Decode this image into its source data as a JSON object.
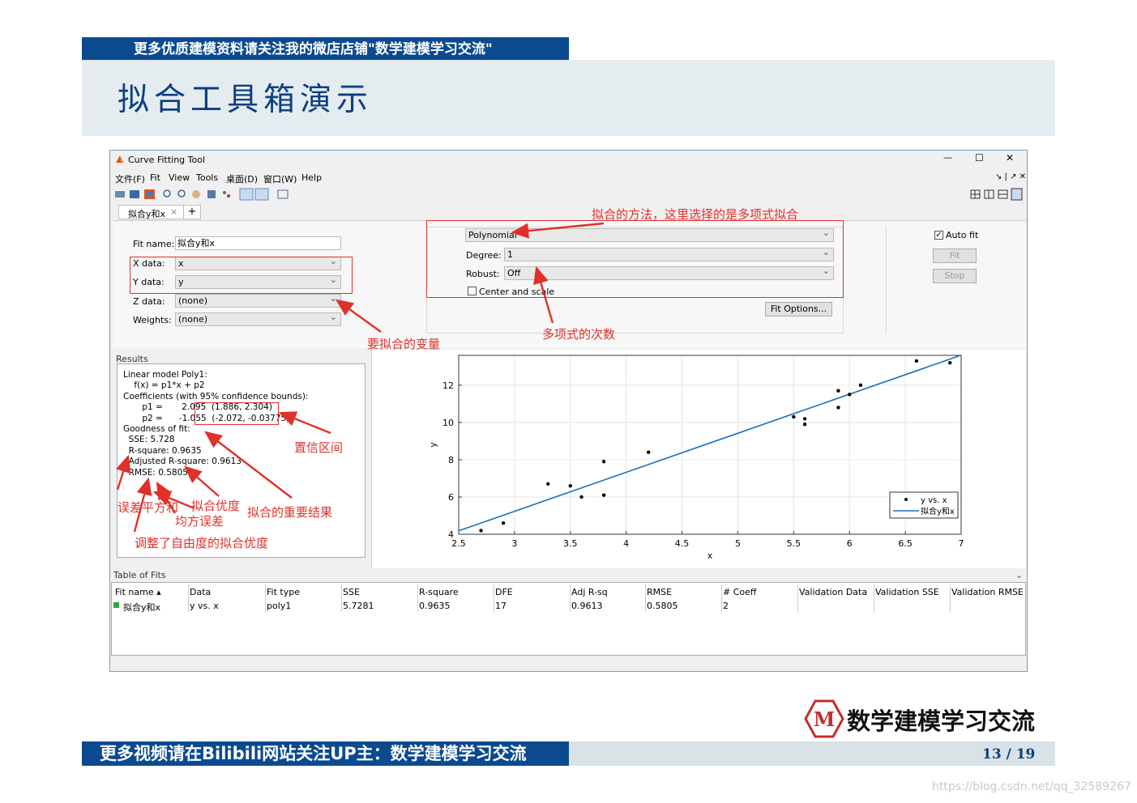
{
  "slide": {
    "banner": "更多优质建模资料请关注我的微店店铺\"数学建模学习交流\"",
    "title": "拟合工具箱演示",
    "footer": "更多视频请在Bilibili网站关注UP主：数学建模学习交流",
    "page": "13 / 19",
    "brand": "数学建模学习交流",
    "logo_letter": "M",
    "watermark": "https://blog.csdn.net/qq_32589267"
  },
  "window": {
    "title": "Curve Fitting Tool",
    "controls": {
      "minimize": "—",
      "maximize": "☐",
      "close": "✕"
    },
    "menu": [
      "文件(F)",
      "Fit",
      "View",
      "Tools",
      "桌面(D)",
      "窗口(W)",
      "Help"
    ],
    "tab": "拟合y和x",
    "tab_close": "×",
    "tab_add": "+"
  },
  "fit": {
    "name_label": "Fit name:",
    "name_value": "拟合y和x",
    "x_label": "X data:",
    "x_value": "x",
    "y_label": "Y data:",
    "y_value": "y",
    "z_label": "Z data:",
    "z_value": "(none)",
    "w_label": "Weights:",
    "w_value": "(none)",
    "method": "Polynomial",
    "degree_label": "Degree:",
    "degree": "1",
    "robust_label": "Robust:",
    "robust": "Off",
    "center_label": "Center and scale",
    "fit_options": "Fit Options...",
    "auto_fit": "Auto fit",
    "fit_btn": "Fit",
    "stop_btn": "Stop"
  },
  "results": {
    "header": "Results",
    "lines": [
      "Linear model Poly1:",
      "    f(x) = p1*x + p2",
      "Coefficients (with 95% confidence bounds):",
      "       p1 =       2.095  (1.886, 2.304)",
      "       p2 =      -1.055  (-2.072, -0.03775)",
      "",
      "Goodness of fit:",
      "  SSE: 5.728",
      "  R-square: 0.9635",
      "  Adjusted R-square: 0.9613",
      "  RMSE: 0.5805"
    ]
  },
  "annotations": {
    "method": "拟合的方法，这里选择的是多项式拟合",
    "vars": "要拟合的变量",
    "degree": "多项式的次数",
    "ci": "置信区间",
    "important": "拟合的重要结果",
    "sse": "误差平方和",
    "r2": "拟合优度",
    "rmse": "均方误差",
    "adj": "调整了自由度的拟合优度"
  },
  "table": {
    "header": "Table of Fits",
    "columns": [
      "Fit name ▴",
      "Data",
      "Fit type",
      "SSE",
      "R-square",
      "DFE",
      "Adj R-sq",
      "RMSE",
      "# Coeff",
      "Validation Data",
      "Validation SSE",
      "Validation RMSE"
    ],
    "rows": [
      [
        "拟合y和x",
        "y vs. x",
        "poly1",
        "5.7281",
        "0.9635",
        "17",
        "0.9613",
        "0.5805",
        "2",
        "",
        "",
        ""
      ]
    ]
  },
  "colors": {
    "banner": "#0b4a8f",
    "line": "#1f6fb5",
    "annotation": "#e0302a"
  },
  "chart_data": {
    "type": "scatter",
    "xlabel": "x",
    "ylabel": "y",
    "xlim": [
      2.5,
      7
    ],
    "ylim": [
      4,
      13.6
    ],
    "xticks": [
      "2.5",
      "3",
      "3.5",
      "4",
      "4.5",
      "5",
      "5.5",
      "6",
      "6.5",
      "7"
    ],
    "yticks": [
      "4",
      "6",
      "8",
      "10",
      "12"
    ],
    "points": [
      [
        2.7,
        4.2
      ],
      [
        2.9,
        4.6
      ],
      [
        3.3,
        6.7
      ],
      [
        3.5,
        6.6
      ],
      [
        3.6,
        6.0
      ],
      [
        3.8,
        6.1
      ],
      [
        3.8,
        7.9
      ],
      [
        4.2,
        8.4
      ],
      [
        5.5,
        10.3
      ],
      [
        5.6,
        10.2
      ],
      [
        5.6,
        9.9
      ],
      [
        5.9,
        11.7
      ],
      [
        5.9,
        10.8
      ],
      [
        6.0,
        11.5
      ],
      [
        6.1,
        12.0
      ],
      [
        6.6,
        13.3
      ],
      [
        6.9,
        13.2
      ]
    ],
    "fit": {
      "p1": 2.095,
      "p2": -1.055
    },
    "legend": [
      "y vs. x",
      "拟合y和x"
    ],
    "legend_position": "bottom-right"
  }
}
